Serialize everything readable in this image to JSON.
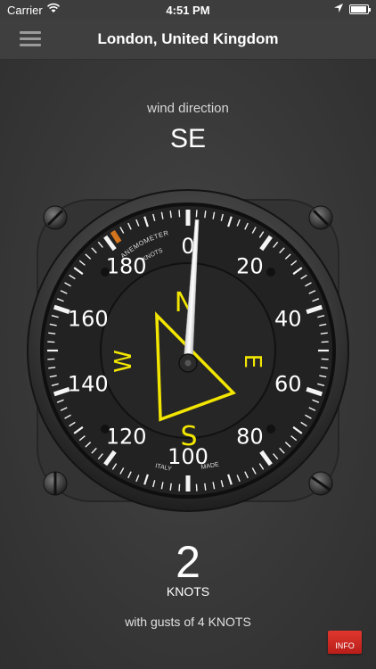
{
  "status_bar": {
    "carrier": "Carrier",
    "time": "4:51 PM",
    "battery_level": 0.9
  },
  "nav": {
    "title": "London, United Kingdom",
    "menu_icon": "hamburger-menu-icon"
  },
  "wind": {
    "direction_label": "wind direction",
    "direction_value": "SE",
    "speed_value": "2",
    "speed_unit": "KNOTS",
    "gusts_text": "with gusts of 4 KNOTS"
  },
  "gauge": {
    "top_text_1": "ANEMOMETER",
    "top_text_2": "KNOTS",
    "bottom_left_text": "ITALY",
    "bottom_right_text": "MADE",
    "scale_labels": [
      "0",
      "20",
      "40",
      "60",
      "80",
      "100",
      "120",
      "140",
      "160",
      "180"
    ],
    "compass": {
      "n": "N",
      "e": "E",
      "s": "S",
      "w": "W"
    },
    "needle_value": 2,
    "scale_max": 200,
    "accent_color": "#f2e600",
    "marker_color": "#d4741c"
  },
  "info_button": {
    "label": "INFO",
    "color": "#d0281f"
  }
}
